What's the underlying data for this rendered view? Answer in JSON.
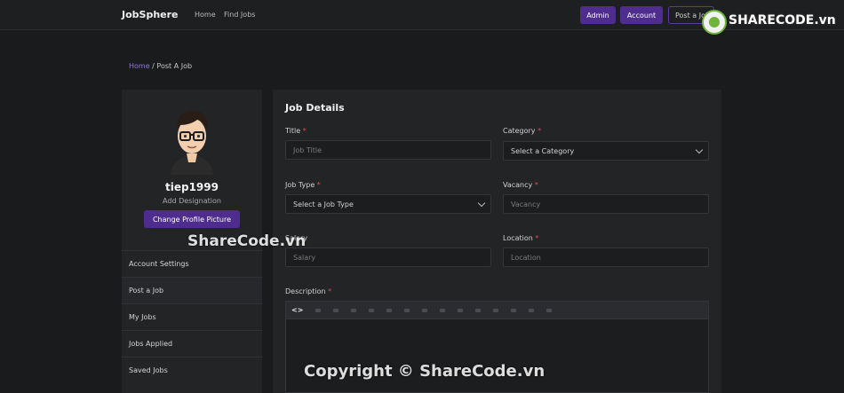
{
  "header": {
    "brand": "JobSphere",
    "nav": [
      "Home",
      "Find Jobs"
    ],
    "buttons": {
      "admin": "Admin",
      "account": "Account",
      "post": "Post a Job"
    }
  },
  "watermark_logo": "SHARECODE.vn",
  "breadcrumb": {
    "home": "Home",
    "separator": "/",
    "current": "Post A Job"
  },
  "profile": {
    "username": "tiep1999",
    "designation": "Add Designation",
    "change_button": "Change Profile Picture"
  },
  "menu": [
    "Account Settings",
    "Post a Job",
    "My Jobs",
    "Jobs Applied",
    "Saved Jobs"
  ],
  "form": {
    "heading": "Job Details",
    "fields": {
      "title": {
        "label": "Title",
        "placeholder": "Job Title"
      },
      "category": {
        "label": "Category",
        "value": "Select a Category"
      },
      "job_type": {
        "label": "Job Type",
        "value": "Select a Job Type"
      },
      "vacancy": {
        "label": "Vacancy",
        "placeholder": "Vacancy"
      },
      "salary": {
        "label": "Salary",
        "placeholder": "Salary"
      },
      "location": {
        "label": "Location",
        "placeholder": "Location"
      },
      "description": {
        "label": "Description"
      }
    },
    "required_mark": "*",
    "editor_code_icon": "<>"
  },
  "watermarks": {
    "center": "ShareCode.vn",
    "bottom": "Copyright © ShareCode.vn"
  },
  "colors": {
    "accent": "#4e2d8e",
    "link": "#8f7bd8",
    "required": "#e0485a"
  }
}
